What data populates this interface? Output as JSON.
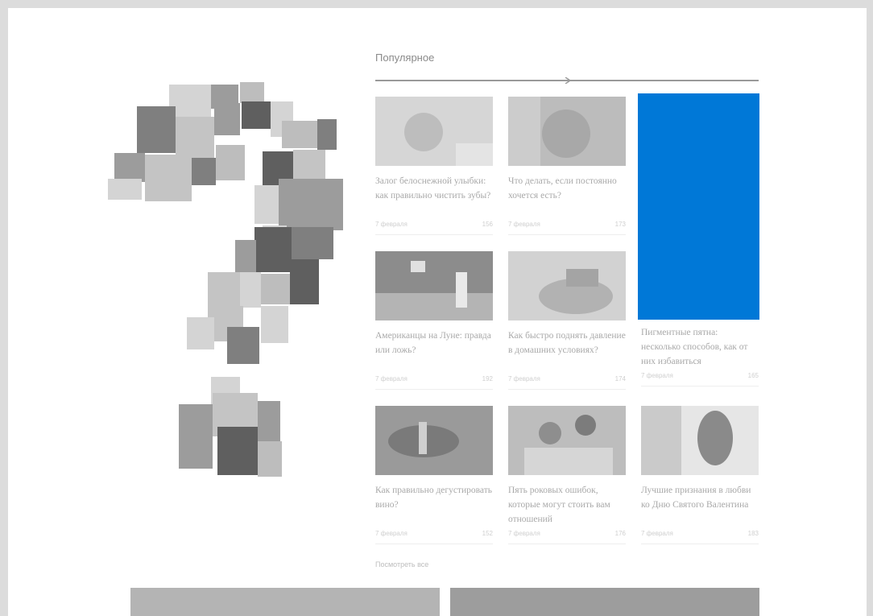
{
  "popular": {
    "title": "Популярное"
  },
  "cards": [
    {
      "title": "Залог белоснежной улыбки: как правильно чистить зубы?",
      "date": "7 февраля",
      "views": "156"
    },
    {
      "title": "Что делать, если постоянно хочется есть?",
      "date": "7 февраля",
      "views": "173"
    },
    {
      "title": "Американцы на Луне: правда или ложь?",
      "date": "7 февраля",
      "views": "192"
    },
    {
      "title": "Как быстро поднять давление в домашних условиях?",
      "date": "7 февраля",
      "views": "174"
    },
    {
      "title": "Пигментные пятна: несколько способов, как от них избавиться",
      "date": "7 февраля",
      "views": "165"
    },
    {
      "title": "Как правильно дегустировать вино?",
      "date": "7 февраля",
      "views": "152"
    },
    {
      "title": "Пять роковых ошибок, которые могут стоить вам отношений",
      "date": "7 февраля",
      "views": "176"
    },
    {
      "title": "Лучшие признания в любви ко Дню Святого Валентина",
      "date": "7 февраля",
      "views": "183"
    }
  ],
  "view_all": "Посмотреть все",
  "colors": {
    "ad_block": "#0078d7",
    "page_bg": "#ffffff",
    "frame_bg": "#dcdcdc"
  }
}
